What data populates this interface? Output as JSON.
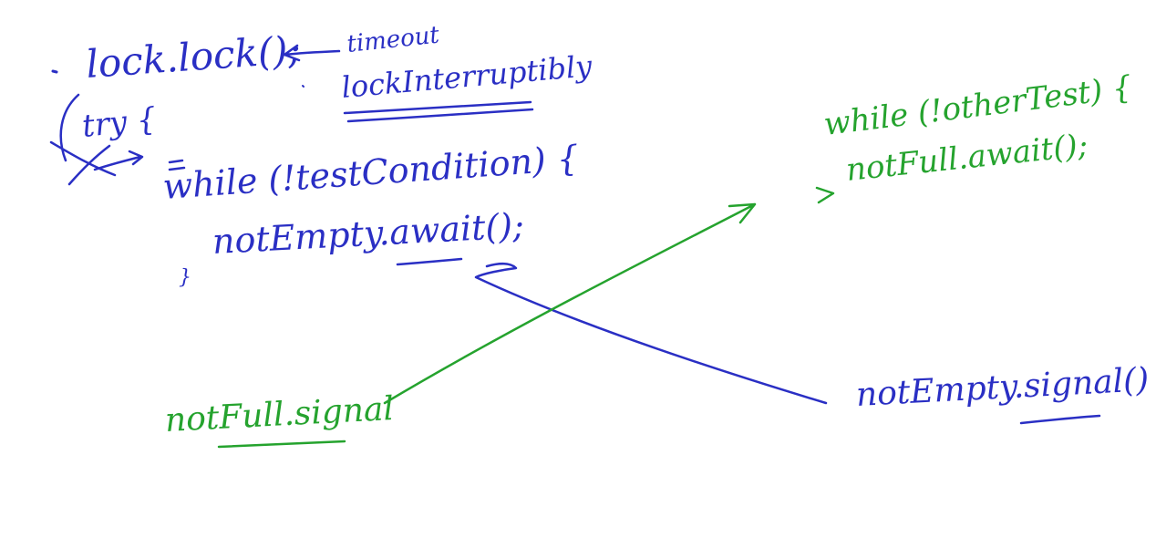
{
  "colors": {
    "background": "#ffffff",
    "blue_ink": "#2a2fc4",
    "green_ink": "#25a32e"
  },
  "notes": {
    "lock_line": "lock.lock();",
    "timeout": "timeout",
    "lock_interruptibly": "lockInterruptibly",
    "try_line": "try {",
    "while_line": "while (!testCondition) {",
    "await_line": "notEmpty.await();",
    "close_brace": "}",
    "other_while": "while (!otherTest) {",
    "other_await": "notFull.await();",
    "notfull_signal": "notFull.signal",
    "notempty_signal": "notEmpty.signal()"
  }
}
